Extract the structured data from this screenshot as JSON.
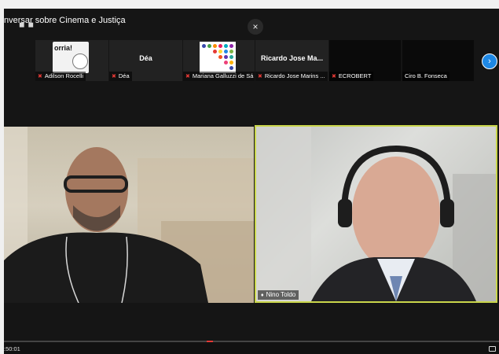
{
  "title": "nversar sobre Cinema e Justiça",
  "close_symbol": "×",
  "next_arrow_symbol": "›",
  "participants": [
    {
      "label": "Adilson Rocelli",
      "muted": true,
      "thumbnail": "poster",
      "poster_text": "orria!"
    },
    {
      "label": "Déa",
      "muted": true,
      "display_name": "Déa"
    },
    {
      "label": "Mariana Galluzzi de Sá",
      "muted": true,
      "thumbnail": "dots"
    },
    {
      "label": "Ricardo Jose Marins ...",
      "muted": true,
      "display_name": "Ricardo Jose Ma..."
    },
    {
      "label": "ECROBERT",
      "muted": true
    },
    {
      "label": "Ciro B. Fonseca",
      "muted": false
    }
  ],
  "videos": {
    "right": {
      "label": "Nino Toldo",
      "active_speaker": true
    }
  },
  "player": {
    "timestamp": ":50:01"
  },
  "colors": {
    "active_speaker_border": "#c9d54a",
    "muted_mic": "#e53935",
    "next_arrow": "#1e88e5",
    "progress_marker": "#e53935"
  },
  "icons": {
    "muted": "microphone-muted-icon",
    "close": "close-icon",
    "next": "chevron-right-icon",
    "settings": "settings-icon"
  }
}
